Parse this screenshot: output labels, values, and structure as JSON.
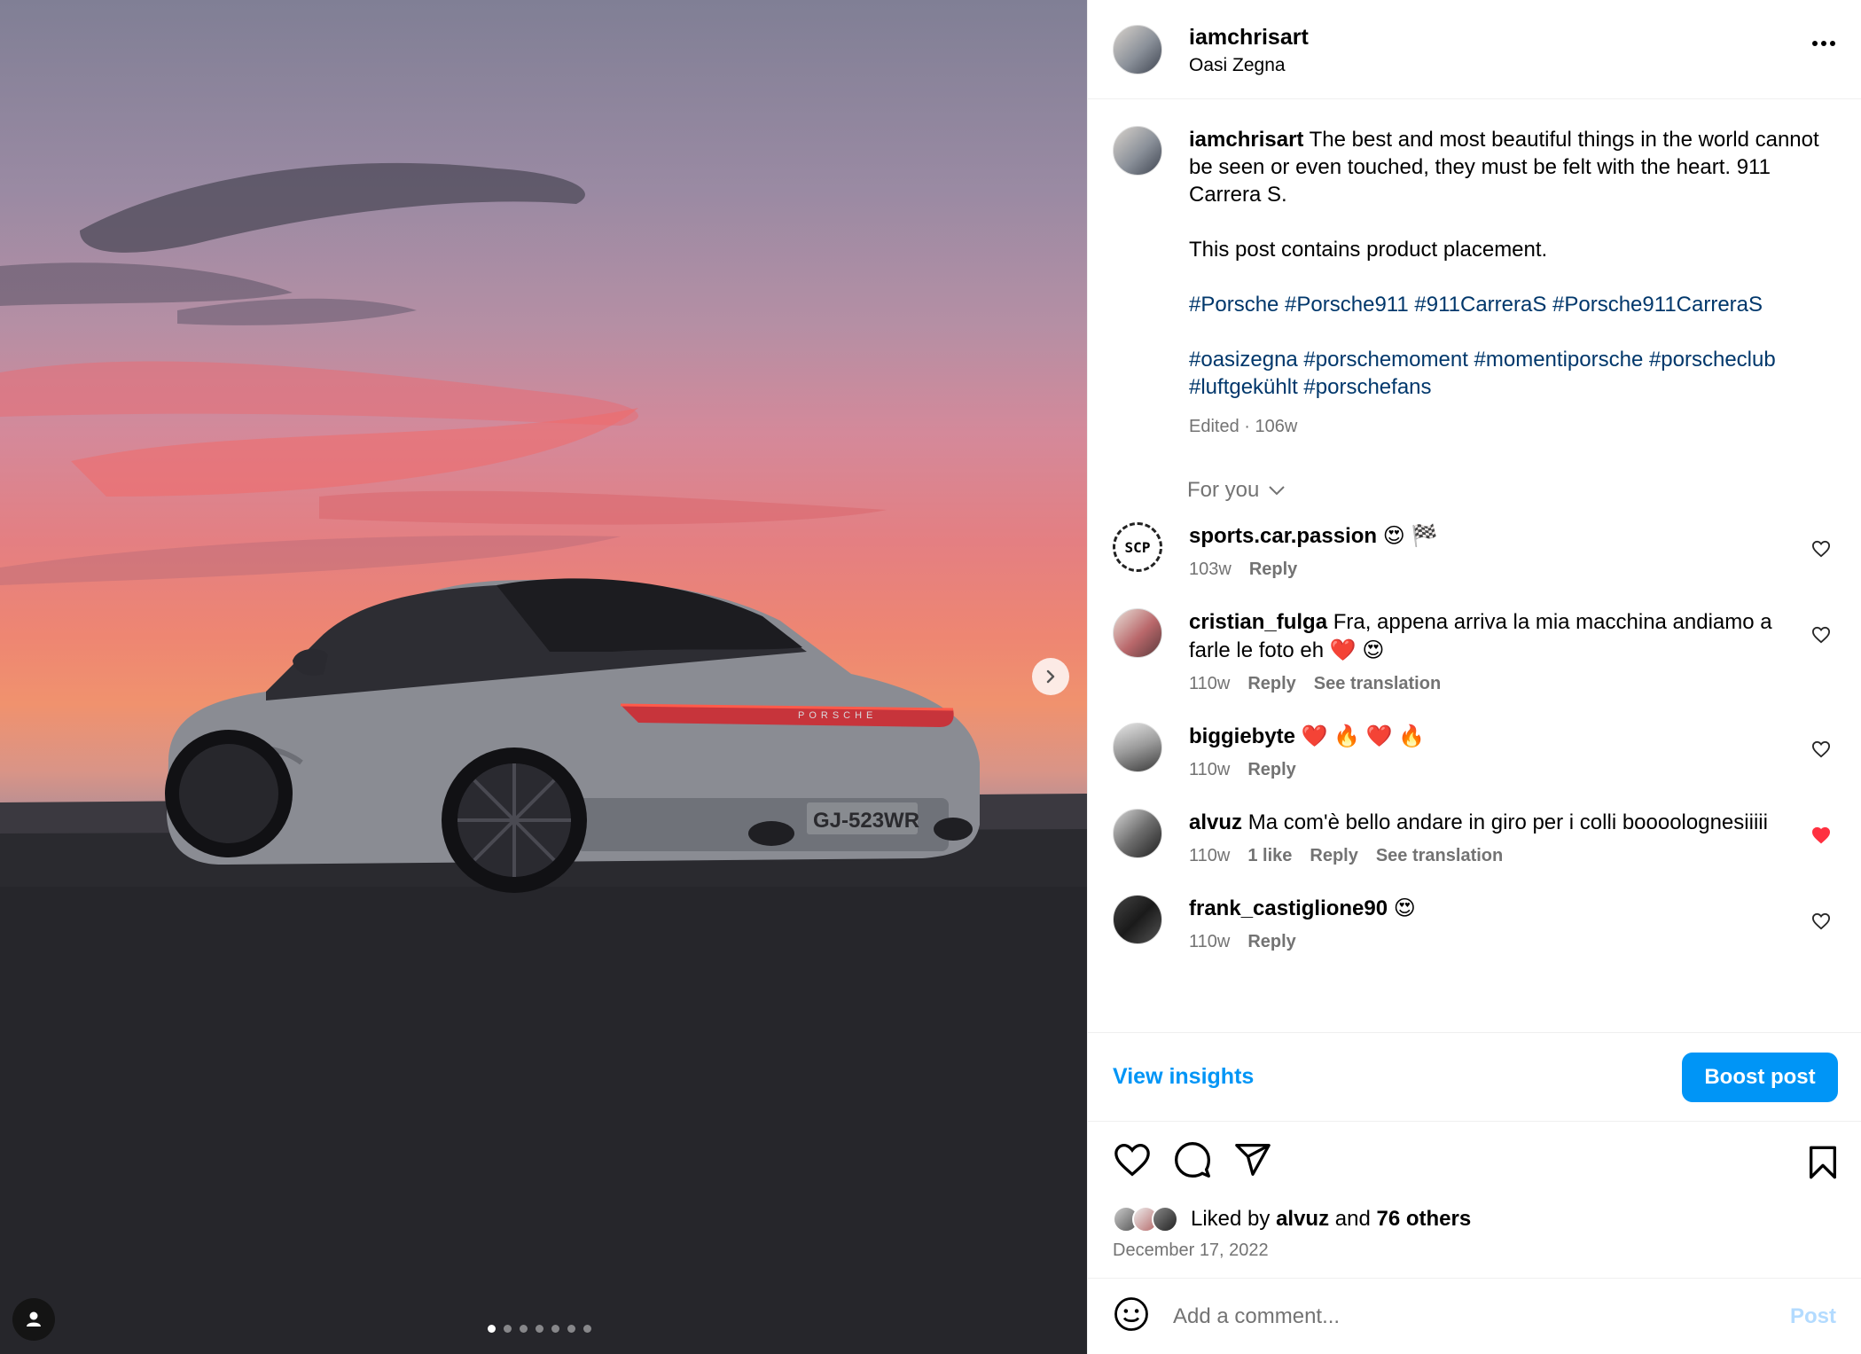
{
  "post": {
    "username": "iamchrisart",
    "location": "Oasi Zegna"
  },
  "media": {
    "plate_text": "GJ-523WR",
    "badge_text": "PORSCHE",
    "carousel_count": 7,
    "carousel_active": 1
  },
  "caption": {
    "username": "iamchrisart",
    "line1": " The best and most beautiful things in the world cannot be seen or even touched, they must be felt with the heart. 911 Carrera S.",
    "line2": "This post contains product placement.",
    "tags_1": "#Porsche #Porsche911 #911CarreraS #Porsche911CarreraS",
    "tags_2": "#oasizegna #porschemoment #momentiporsche #porscheclub #luftgekühlt #porschefans",
    "edited": "Edited · 106w"
  },
  "comments_filter": "For you",
  "comments": [
    {
      "username": "sports.car.passion",
      "text": " 😍 🏁",
      "age": "103w",
      "likes": "",
      "reply": "Reply",
      "translate": "",
      "liked": false
    },
    {
      "username": "cristian_fulga",
      "text": " Fra, appena arriva la mia macchina andiamo a farle le foto eh ❤️ 😍",
      "age": "110w",
      "likes": "",
      "reply": "Reply",
      "translate": "See translation",
      "liked": false
    },
    {
      "username": "biggiebyte",
      "text": " ❤️ 🔥 ❤️ 🔥",
      "age": "110w",
      "likes": "",
      "reply": "Reply",
      "translate": "",
      "liked": false
    },
    {
      "username": "alvuz",
      "text": " Ma com'è bello andare in giro per i colli boooolognesiiiii",
      "age": "110w",
      "likes": "1 like",
      "reply": "Reply",
      "translate": "See translation",
      "liked": true
    },
    {
      "username": "frank_castiglione90",
      "text": " 😍",
      "age": "110w",
      "likes": "",
      "reply": "Reply",
      "translate": "",
      "liked": false
    }
  ],
  "insights": {
    "view_label": "View insights",
    "boost_label": "Boost post"
  },
  "likes": {
    "prefix": "Liked by ",
    "user": "alvuz",
    "mid": " and ",
    "others": "76 others"
  },
  "date": "December 17, 2022",
  "comment_box": {
    "placeholder": "Add a comment...",
    "post_label": "Post"
  },
  "colors": {
    "accent": "#0095f6",
    "link": "#00376b",
    "muted": "#737373",
    "like_red": "#ff3040"
  },
  "icons": [
    "more-icon",
    "chevron-right-icon",
    "person-icon",
    "chevron-down-icon",
    "heart-icon",
    "comment-icon",
    "share-icon",
    "bookmark-icon",
    "emoji-icon"
  ]
}
